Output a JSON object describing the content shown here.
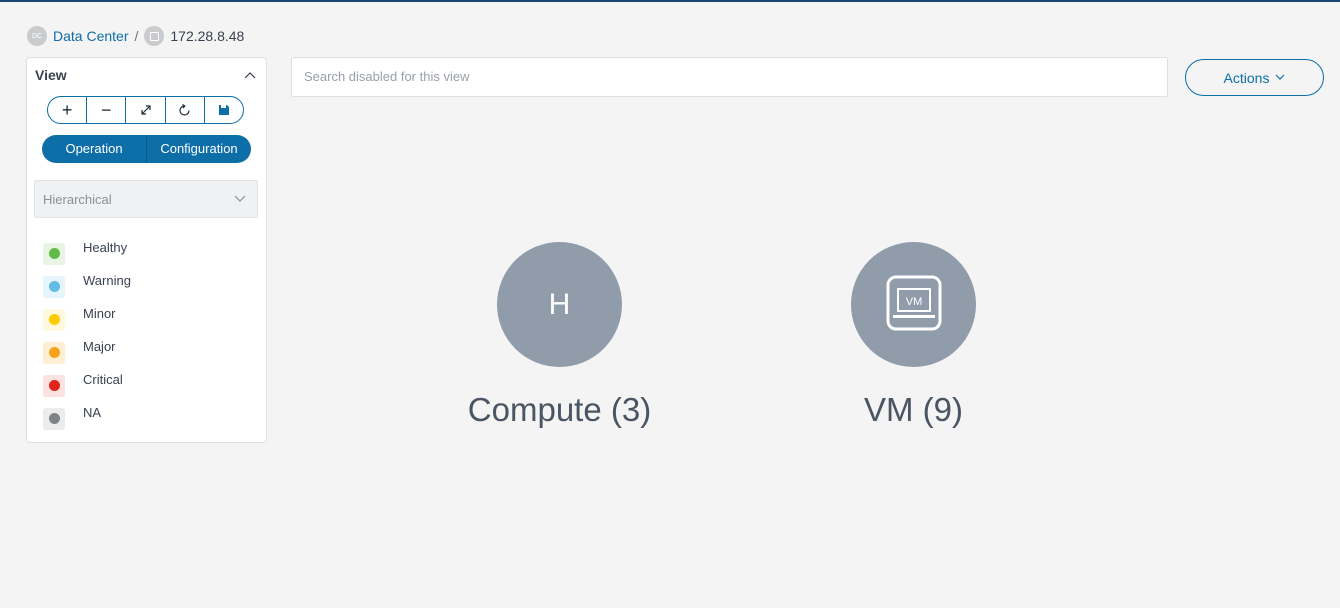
{
  "breadcrumb": {
    "root_badge": "DC",
    "root_label": "Data Center",
    "separator": "/",
    "current_label": "172.28.8.48"
  },
  "view_panel": {
    "title": "View",
    "toolbar": {
      "zoom_in": "+",
      "zoom_out": "−",
      "fit_icon": "expand-icon",
      "refresh_icon": "refresh-icon",
      "save_icon": "save-icon"
    },
    "modes": [
      "Operation",
      "Configuration"
    ],
    "selected_mode": "Operation",
    "layout_select": "Hierarchical",
    "legend": [
      {
        "label": "Healthy",
        "color": "#5fbb46",
        "bg": "#e8f5e4"
      },
      {
        "label": "Warning",
        "color": "#64bbe3",
        "bg": "#e6f4fb"
      },
      {
        "label": "Minor",
        "color": "#ffcc00",
        "bg": "#fff8dc"
      },
      {
        "label": "Major",
        "color": "#f7a21b",
        "bg": "#fdeed4"
      },
      {
        "label": "Critical",
        "color": "#e2231a",
        "bg": "#fbe1df"
      },
      {
        "label": "NA",
        "color": "#7f8287",
        "bg": "#ececed"
      }
    ]
  },
  "search": {
    "placeholder": "Search disabled for this view"
  },
  "actions_label": "Actions",
  "nodes": {
    "compute": {
      "icon_text": "H",
      "label": "Compute (3)"
    },
    "vm": {
      "icon_text": "VM",
      "label": "VM (9)"
    }
  },
  "colors": {
    "accent": "#0d6ea8",
    "node": "#919cab"
  }
}
